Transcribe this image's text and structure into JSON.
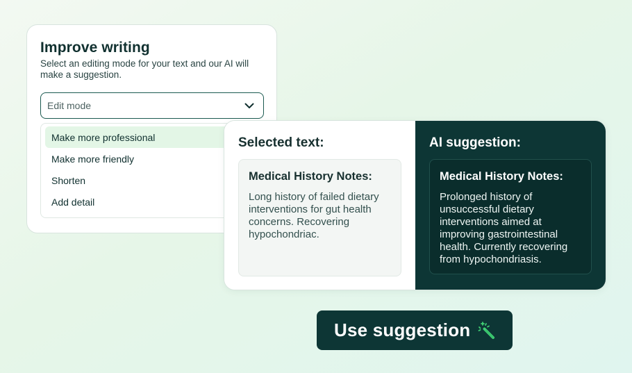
{
  "improve": {
    "title": "Improve writing",
    "subtitle": "Select an editing mode for your text and our AI will make a suggestion.",
    "select_value": "Edit mode",
    "options": [
      {
        "label": "Make more professional",
        "selected": true
      },
      {
        "label": "Make more friendly",
        "selected": false
      },
      {
        "label": "Shorten",
        "selected": false
      },
      {
        "label": "Add detail",
        "selected": false
      }
    ]
  },
  "selected": {
    "heading": "Selected text:",
    "box_title": "Medical History Notes:",
    "box_text": "Long history of failed dietary interventions for gut health concerns. Recovering hypochondriac."
  },
  "suggestion": {
    "heading": "AI suggestion:",
    "box_title": "Medical History Notes:",
    "box_text": "Prolonged history of unsuccessful dietary interventions aimed at improving gastrointestinal health. Currently recovering from hypochondriasis."
  },
  "button": {
    "label": "Use suggestion",
    "icon": "magic-wand-icon"
  },
  "colors": {
    "dark_teal": "#0d3635",
    "selected_option_bg": "#e3f6e6",
    "wand_green": "#3fcf74"
  }
}
